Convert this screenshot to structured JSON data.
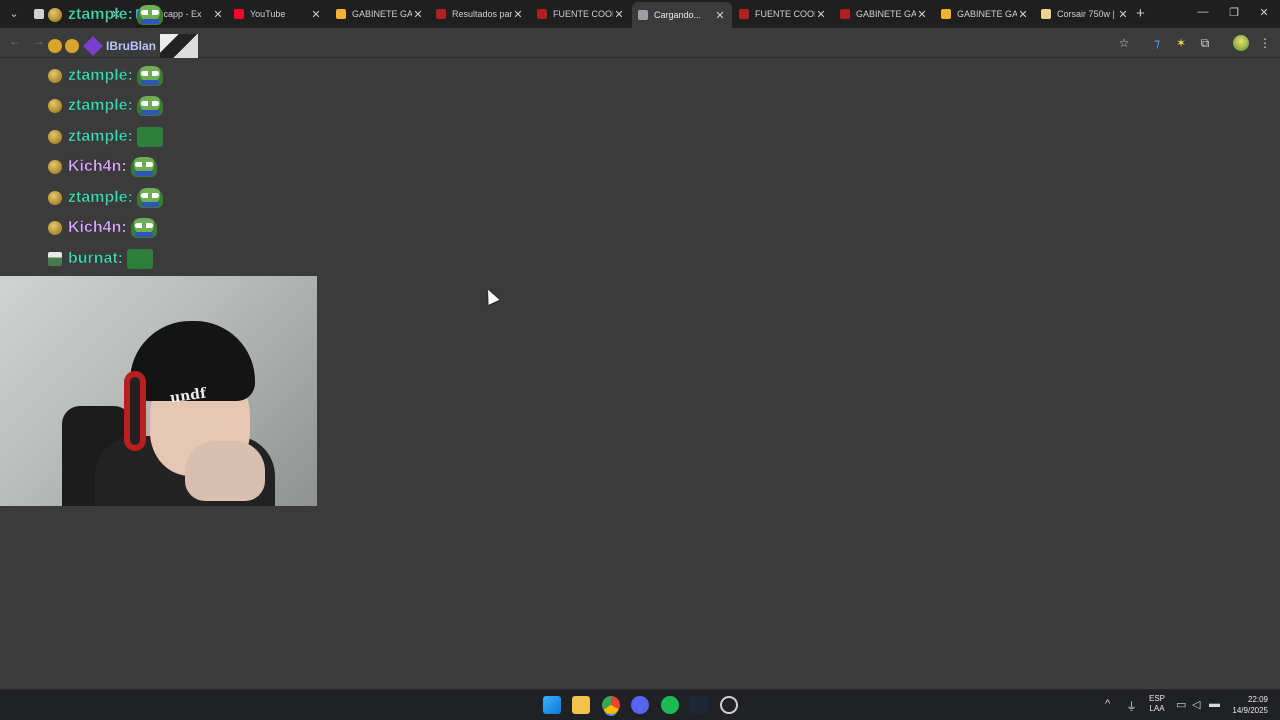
{
  "browser": {
    "tabs": [
      {
        "title": "",
        "favicon_color": "#d0d0d0",
        "active": false
      },
      {
        "title": "Recapp - Ex",
        "favicon_color": "#3aa0ff",
        "active": false
      },
      {
        "title": "YouTube",
        "favicon_color": "#ff0033",
        "active": false
      },
      {
        "title": "GABINETE GAM",
        "favicon_color": "#f2b233",
        "active": false
      },
      {
        "title": "Resultados par",
        "favicon_color": "#b02020",
        "active": false
      },
      {
        "title": "FUENTE COOL",
        "favicon_color": "#b02020",
        "active": false
      },
      {
        "title": "Cargando...",
        "favicon_color": "#9aa0a6",
        "active": true
      },
      {
        "title": "FUENTE COOL",
        "favicon_color": "#b02020",
        "active": false
      },
      {
        "title": "GABINETE GAM",
        "favicon_color": "#b02020",
        "active": false
      },
      {
        "title": "GABINETE GAM",
        "favicon_color": "#f2b233",
        "active": false
      },
      {
        "title": "Corsair 750w |",
        "favicon_color": "#e8d48a",
        "active": false
      }
    ],
    "new_tab_symbol": "+",
    "window_controls": {
      "minimize": "—",
      "restore": "❐",
      "close": "✕"
    }
  },
  "toolbar": {
    "back": "←",
    "forward": "→",
    "alert_name": "IBruBlan"
  },
  "chat": {
    "messages": [
      {
        "user": "ztample:",
        "color": "#41d6b0",
        "emote": "frog"
      },
      {
        "user": "ztample:",
        "color": "#41d6b0",
        "emote": "frog"
      },
      {
        "user": "ztample:",
        "color": "#41d6b0",
        "emote": "frog"
      },
      {
        "user": "ztample:",
        "color": "#41d6b0",
        "emote": "box"
      },
      {
        "user": "Kich4n:",
        "color": "#d9a6ff",
        "emote": "frog"
      },
      {
        "user": "ztample:",
        "color": "#41d6b0",
        "emote": "frog"
      },
      {
        "user": "Kich4n:",
        "color": "#d9a6ff",
        "emote": "frog"
      },
      {
        "user": "burnat:",
        "color": "#41d6b0",
        "emote": "box"
      }
    ]
  },
  "webcam": {
    "beanie_text": "undf"
  },
  "taskbar": {
    "lang_top": "ESP",
    "lang_bottom": "LAA",
    "time": "22:09",
    "date": "14/9/2025"
  }
}
